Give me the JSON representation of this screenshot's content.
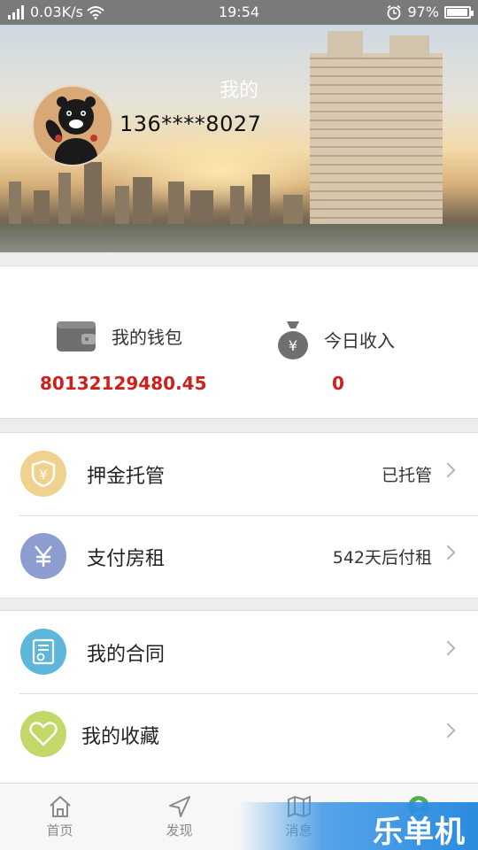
{
  "status_bar": {
    "network_speed": "0.03K/s",
    "time": "19:54",
    "battery_percent": "97%",
    "battery_level": 0.97
  },
  "header": {
    "title": "我的",
    "phone": "136****8027"
  },
  "wallet": {
    "my_wallet_label": "我的钱包",
    "my_wallet_amount": "80132129480.45",
    "today_income_label": "今日收入",
    "today_income_amount": "0"
  },
  "groups": [
    {
      "items": [
        {
          "label": "押金托管",
          "value": "已托管",
          "icon": "shield-yen-icon",
          "color": "#f0d28f"
        },
        {
          "label": "支付房租",
          "value": "542天后付租",
          "icon": "yen-icon",
          "color": "#8e9dd0"
        }
      ]
    },
    {
      "items": [
        {
          "label": "我的合同",
          "value": "",
          "icon": "contract-icon",
          "color": "#5fb6dd"
        },
        {
          "label": "我的收藏",
          "value": "",
          "icon": "heart-icon",
          "color": "#c2d96a"
        }
      ]
    }
  ],
  "tabs": [
    {
      "label": "首页",
      "icon": "home-icon"
    },
    {
      "label": "发现",
      "icon": "send-icon"
    },
    {
      "label": "消息",
      "icon": "map-icon"
    },
    {
      "label": "",
      "icon": "profile-icon"
    }
  ],
  "watermark": "乐单机",
  "colors": {
    "accent_red": "#d0201c",
    "status_bar": "#7a7a7a"
  }
}
